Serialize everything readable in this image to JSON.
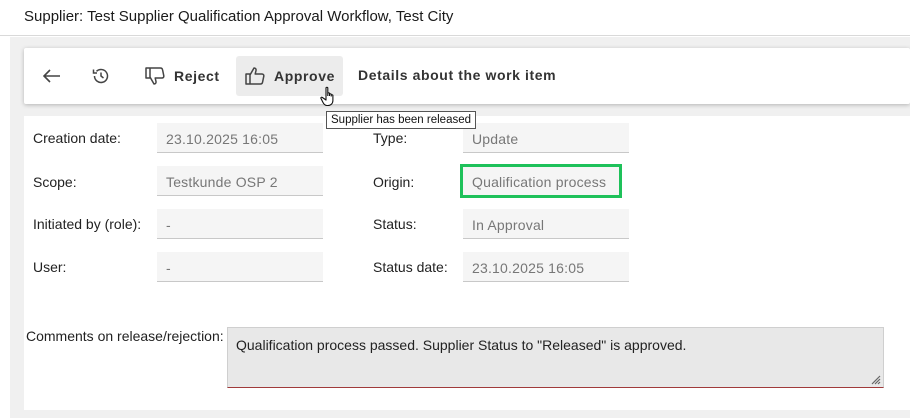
{
  "window": {
    "title": "Supplier: Test Supplier Qualification Approval Workflow, Test City"
  },
  "toolbar": {
    "back_icon": "arrow-left-icon",
    "history_icon": "history-icon",
    "reject_label": "Reject",
    "reject_icon": "thumbs-down-icon",
    "approve_label": "Approve",
    "approve_icon": "thumbs-up-icon",
    "details_text": "Details about the work item"
  },
  "tooltip": {
    "text": "Supplier has been released"
  },
  "fields": {
    "creation_date": {
      "label": "Creation date:",
      "value": "23.10.2025 16:05"
    },
    "scope": {
      "label": "Scope:",
      "value": "Testkunde OSP 2"
    },
    "initiated_by": {
      "label": "Initiated by (role):",
      "value": "-"
    },
    "user": {
      "label": "User:",
      "value": "-"
    },
    "type": {
      "label": "Type:",
      "value": "Update"
    },
    "origin": {
      "label": "Origin:",
      "value": "Qualification process"
    },
    "status": {
      "label": "Status:",
      "value": "In Approval"
    },
    "status_date": {
      "label": "Status date:",
      "value": "23.10.2025 16:05"
    }
  },
  "comment": {
    "label": "Comments on release/rejection:",
    "value": "Qualification process passed. Supplier Status to \"Released\" is approved."
  },
  "colors": {
    "highlight": "#1ec15a",
    "comment_underline": "#a03a3a"
  }
}
